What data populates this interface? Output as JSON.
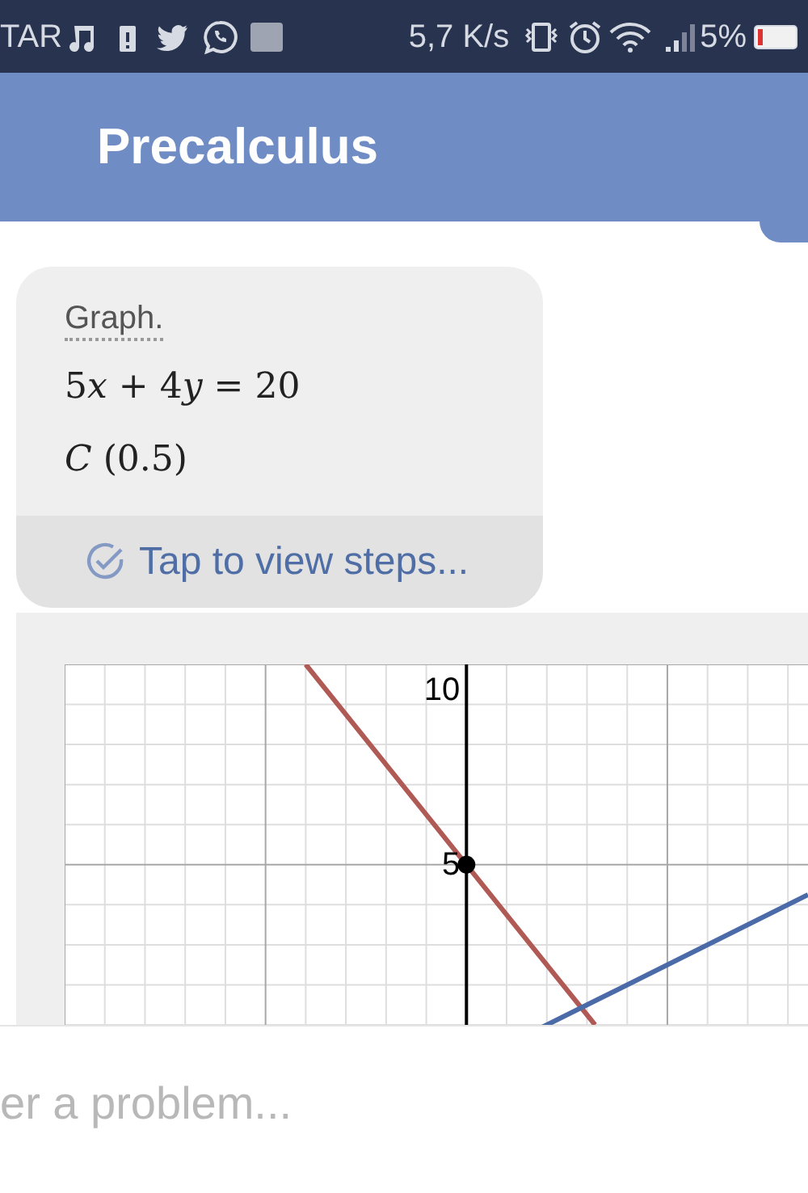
{
  "status_bar": {
    "carrier": "TAR",
    "speed": "5,7 K/s",
    "battery": "5%"
  },
  "app_bar": {
    "title": "Precalculus"
  },
  "problem_card": {
    "label": "Graph.",
    "lines": [
      [
        {
          "text": "5"
        },
        {
          "text": "x",
          "italic": true
        },
        {
          "text": " + 4"
        },
        {
          "text": "y",
          "italic": true
        },
        {
          "text": " = 20"
        }
      ],
      [
        {
          "text": "C",
          "italic": true
        },
        {
          "text": " (0.5)"
        }
      ]
    ],
    "steps_link": "Tap to view steps..."
  },
  "graph": {
    "tick_labels": [
      "10",
      "5"
    ]
  },
  "input": {
    "placeholder": "er a problem..."
  }
}
